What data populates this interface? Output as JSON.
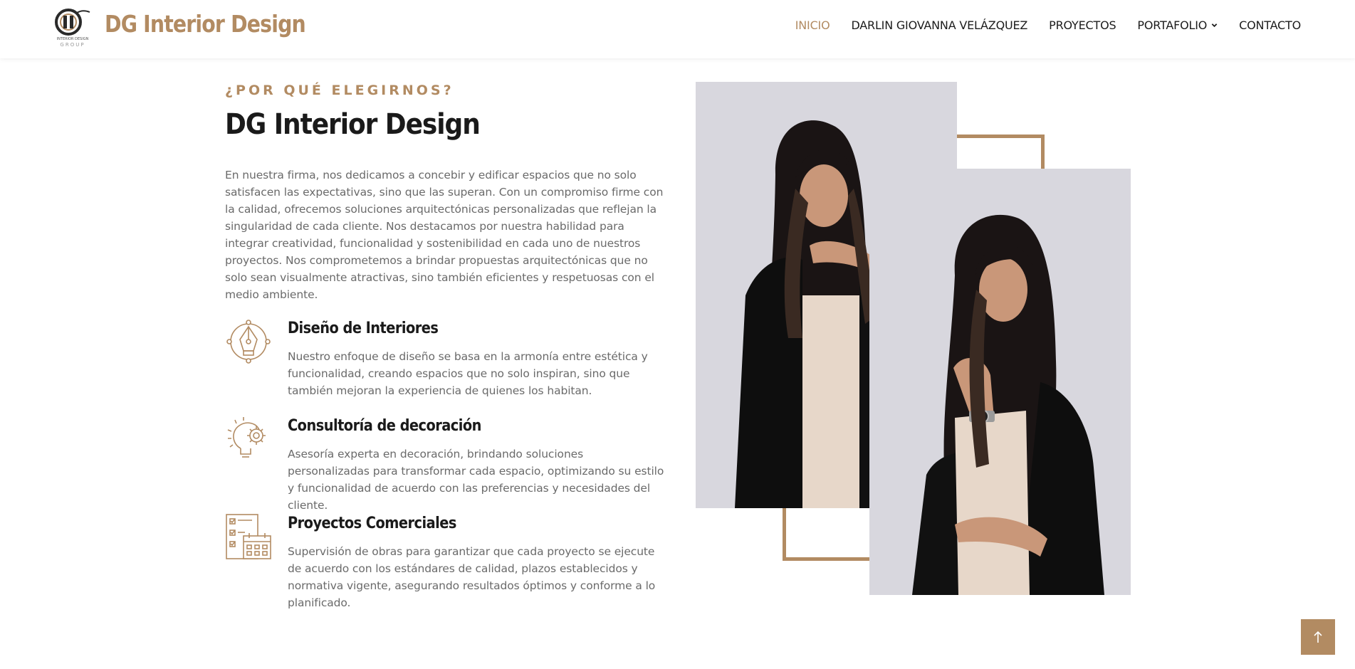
{
  "brand": {
    "name": "DG Interior Design",
    "logo_caption": "INTERIOR DESIGN",
    "logo_group": "GROUP",
    "accent_color": "#b28b62"
  },
  "nav": {
    "items": [
      {
        "label": "INICIO",
        "active": true
      },
      {
        "label": "DARLIN GIOVANNA VELÁZQUEZ",
        "active": false
      },
      {
        "label": "PROYECTOS",
        "active": false
      },
      {
        "label": "PORTAFOLIO",
        "active": false,
        "has_dropdown": true
      },
      {
        "label": "CONTACTO",
        "active": false
      }
    ]
  },
  "about": {
    "eyebrow": "¿POR QUÉ ELEGIRNOS?",
    "title": "DG Interior Design",
    "intro": "En nuestra firma, nos dedicamos a concebir y edificar espacios que no solo satisfacen las expectativas, sino que las superan. Con un compromiso firme con la calidad, ofrecemos soluciones arquitectónicas personalizadas que reflejan la singularidad de cada cliente. Nos destacamos por nuestra habilidad para integrar creatividad, funcionalidad y sostenibilidad en cada uno de nuestros proyectos. Nos comprometemos a brindar propuestas arquitectónicas que no solo sean visualmente atractivas, sino también eficientes y respetuosas con el medio ambiente.",
    "features": [
      {
        "icon": "pen-nib-icon",
        "title": "Diseño de Interiores",
        "text": "Nuestro enfoque de diseño se basa en la armonía entre estética y funcionalidad, creando espacios que no solo inspiran, sino que también mejoran la experiencia de quienes los habitan."
      },
      {
        "icon": "lightbulb-gear-icon",
        "title": "Consultoría de decoración",
        "text": "Asesoría experta en decoración, brindando soluciones personalizadas para transformar cada espacio, optimizando su estilo y funcionalidad de acuerdo con las preferencias y necesidades del cliente."
      },
      {
        "icon": "checklist-calendar-icon",
        "title": "Proyectos Comerciales",
        "text": "Supervisión de obras para garantizar que cada proyecto se ejecute de acuerdo con los estándares de calidad, plazos establecidos y normativa vigente, asegurando resultados óptimos y conforme a lo planificado."
      }
    ]
  },
  "photos": {
    "first": "portrait-photo",
    "second": "portrait-photo"
  },
  "back_to_top": {
    "icon": "arrow-up-icon"
  }
}
